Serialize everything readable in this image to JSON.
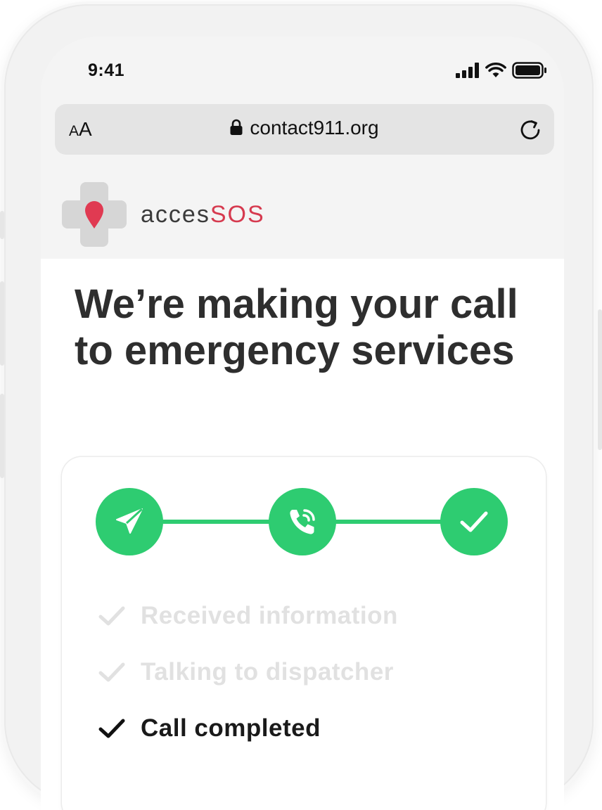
{
  "status_bar": {
    "time": "9:41"
  },
  "browser": {
    "text_size_small": "A",
    "text_size_large": "A",
    "url": "contact911.org"
  },
  "brand": {
    "name_prefix": "acces",
    "name_accent": "SOS",
    "accent_color": "#d63a4f"
  },
  "page": {
    "headline": "We’re making your call to emergency services"
  },
  "progress": {
    "color": "#2ecc71",
    "steps": [
      {
        "icon": "send-icon"
      },
      {
        "icon": "phone-call-icon"
      },
      {
        "icon": "checkmark-icon"
      }
    ],
    "items": [
      {
        "label": "Received information",
        "state": "done"
      },
      {
        "label": "Talking to dispatcher",
        "state": "done"
      },
      {
        "label": "Call completed",
        "state": "current"
      }
    ]
  }
}
